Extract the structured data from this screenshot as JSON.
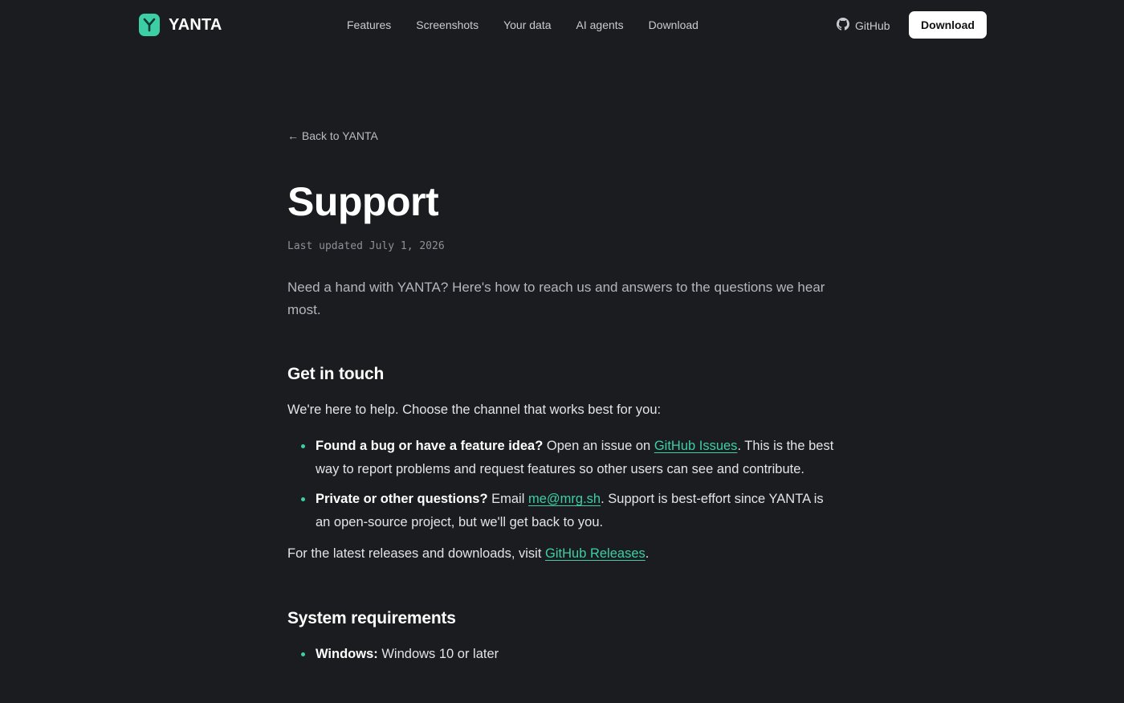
{
  "header": {
    "brand": "YANTA",
    "nav": [
      "Features",
      "Screenshots",
      "Your data",
      "AI agents",
      "Download"
    ],
    "github_label": "GitHub",
    "download_button": "Download"
  },
  "page": {
    "back_link": "← Back to YANTA",
    "title": "Support",
    "updated": "Last updated July 1, 2026",
    "lede": "Need a hand with YANTA? Here's how to reach us and answers to the questions we hear most."
  },
  "get_in_touch": {
    "heading": "Get in touch",
    "intro": "We're here to help. Choose the channel that works best for you:",
    "items": [
      {
        "bold": "Found a bug or have a feature idea?",
        "pre": " Open an issue on ",
        "link": "GitHub Issues",
        "post": ". This is the best way to report problems and request features so other users can see and contribute."
      },
      {
        "bold": "Private or other questions?",
        "pre": " Email ",
        "link": "me@mrg.sh",
        "post": ". Support is best-effort since YANTA is an open-source project, but we'll get back to you."
      }
    ],
    "releases_pre": "For the latest releases and downloads, visit ",
    "releases_link": "GitHub Releases",
    "releases_post": "."
  },
  "system_requirements": {
    "heading": "System requirements",
    "items": [
      {
        "bold": "Windows:",
        "text": " Windows 10 or later"
      }
    ]
  },
  "colors": {
    "background": "#1b1c1f",
    "accent": "#3ccfa6",
    "button_bg": "#ffffff"
  },
  "icons": [
    "yanta-logo-icon",
    "github-icon",
    "bullet-dot-icon"
  ]
}
